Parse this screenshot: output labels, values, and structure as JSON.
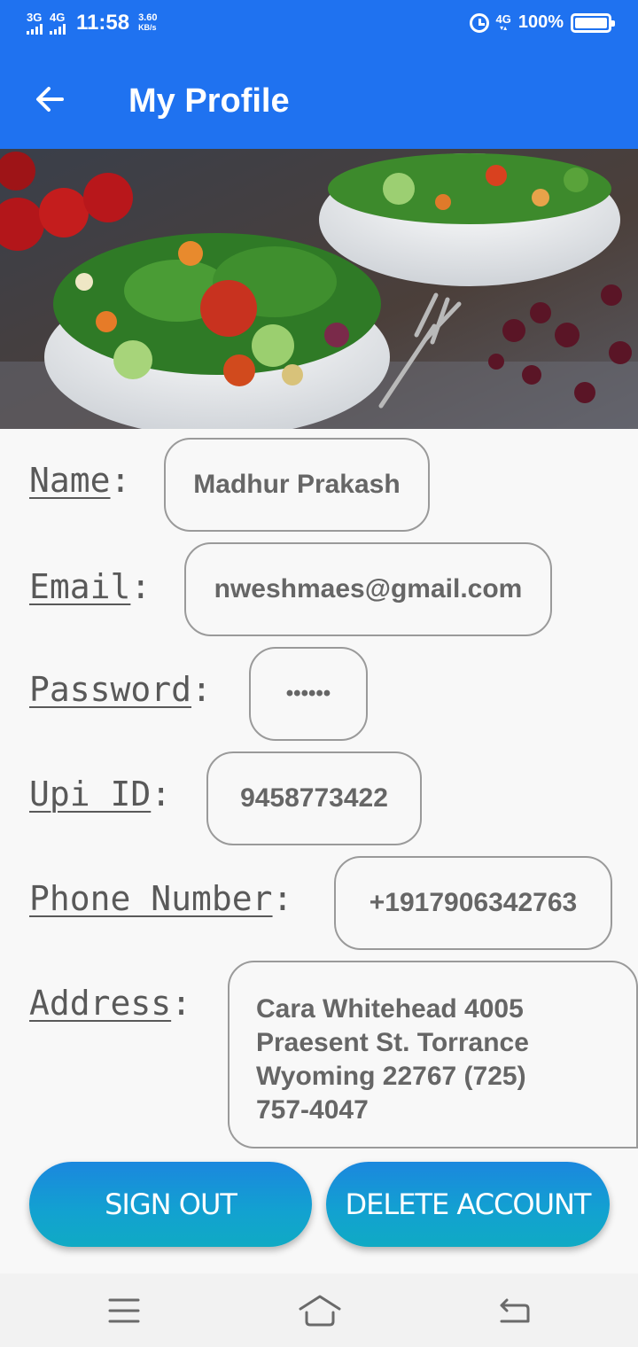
{
  "status_bar": {
    "signal1": "3G",
    "signal2": "4G",
    "time": "11:58",
    "speed_value": "3.60",
    "speed_unit": "KB/s",
    "network": "4G",
    "network_sub": "2",
    "battery": "100%",
    "battery_level": 1.0,
    "icons": [
      "alarm-icon",
      "network-icon",
      "battery-icon"
    ]
  },
  "app_bar": {
    "title": "My Profile",
    "back_icon": "back-arrow-icon"
  },
  "banner": {
    "image": "salad-bowls-photo"
  },
  "profile": {
    "name_label": "Name",
    "name_value": "Madhur Prakash",
    "email_label": "Email",
    "email_value": "nweshmaes@gmail.com",
    "password_label": "Password",
    "password_value": "••••••",
    "upi_label": "Upi ID",
    "upi_value": "9458773422",
    "phone_label": "Phone Number",
    "phone_value": "+1917906342763",
    "address_label": "Address",
    "address_value": "Cara Whitehead 4005 Praesent St. Torrance Wyoming 22767 (725) 757-4047",
    "colon": ":"
  },
  "actions": {
    "sign_out": "SIGN OUT",
    "delete_account": "DELETE ACCOUNT"
  },
  "nav_bar": {
    "icons": [
      "menu-icon",
      "home-icon",
      "back-icon"
    ]
  },
  "colors": {
    "primary": "#1f72f0",
    "button_gradient_top": "#1b87de",
    "button_gradient_bottom": "#10aac4",
    "field_border": "#9a9a9a",
    "text": "#666666"
  }
}
